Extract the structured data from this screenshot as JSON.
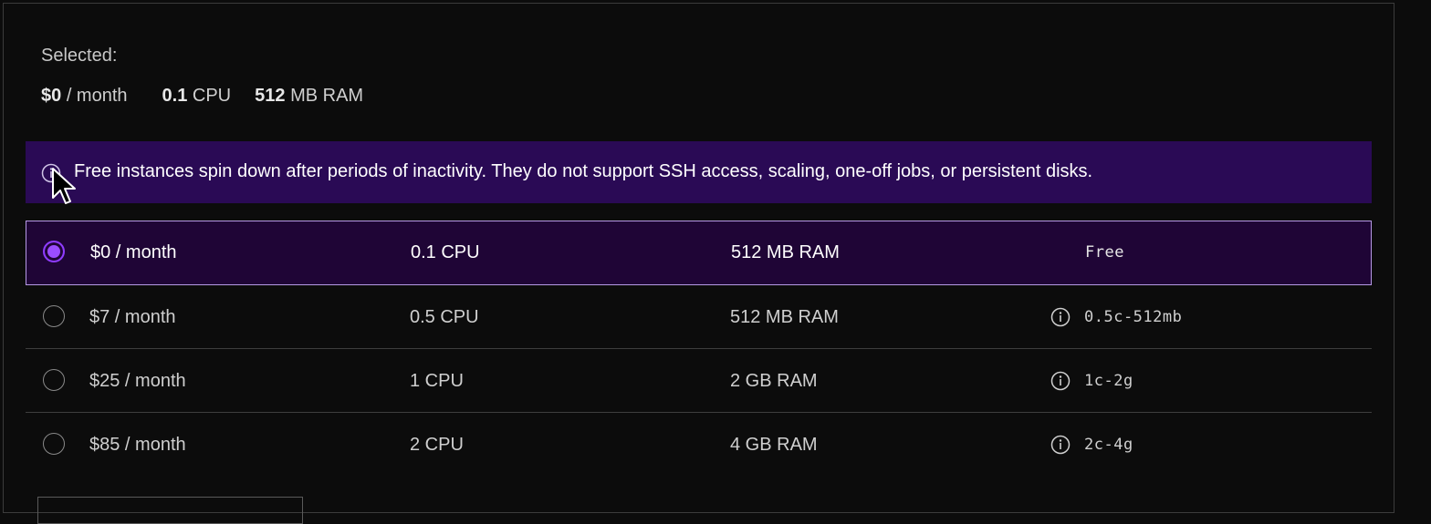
{
  "summary": {
    "selected_label": "Selected:",
    "price_value": "$0",
    "price_unit": "/ month",
    "cpu_value": "0.1",
    "cpu_unit": "CPU",
    "ram_value": "512",
    "ram_unit": "MB RAM"
  },
  "notice": {
    "icon": "info-icon",
    "text": "Free instances spin down after periods of inactivity. They do not support SSH access, scaling, one-off jobs, or persistent disks."
  },
  "plans": [
    {
      "price": "$0 / month",
      "cpu": "0.1 CPU",
      "ram": "512 MB RAM",
      "tag": "Free",
      "selected": true,
      "has_info_icon": false
    },
    {
      "price": "$7 / month",
      "cpu": "0.5 CPU",
      "ram": "512 MB RAM",
      "tag": "0.5c-512mb",
      "selected": false,
      "has_info_icon": true
    },
    {
      "price": "$25 / month",
      "cpu": "1 CPU",
      "ram": "2 GB RAM",
      "tag": "1c-2g",
      "selected": false,
      "has_info_icon": true
    },
    {
      "price": "$85 / month",
      "cpu": "2 CPU",
      "ram": "4 GB RAM",
      "tag": "2c-4g",
      "selected": false,
      "has_info_icon": true
    }
  ],
  "colors": {
    "background": "#0c0c0c",
    "notice_bg": "#2a0a55",
    "selected_row_bg": "#1f0536",
    "selected_border": "#b79ae6",
    "radio_accent": "#8f3cff"
  }
}
